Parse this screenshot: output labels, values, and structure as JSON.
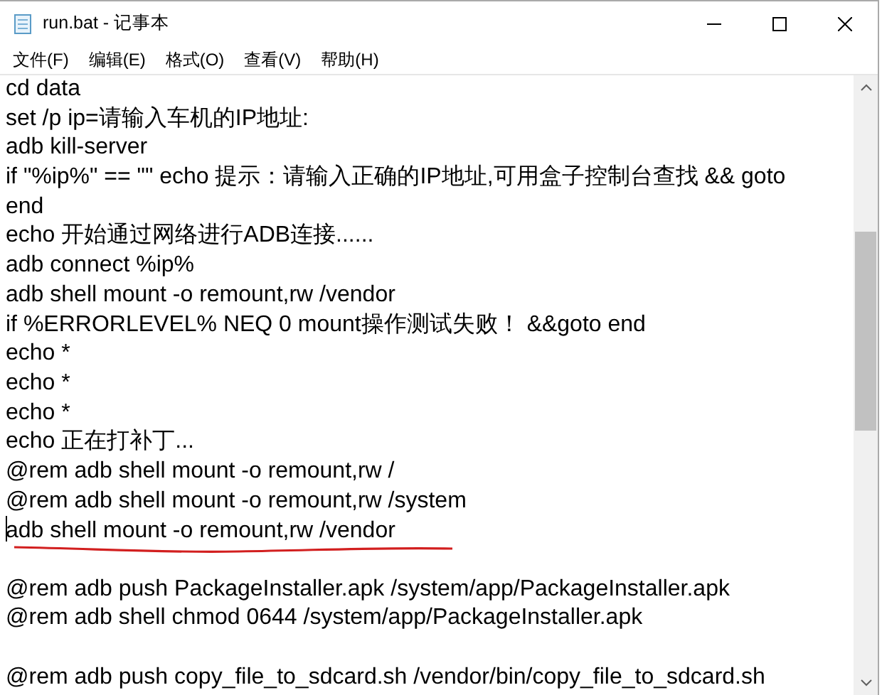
{
  "window": {
    "title": "run.bat - 记事本"
  },
  "menu": [
    "文件(F)",
    "编辑(E)",
    "格式(O)",
    "查看(V)",
    "帮助(H)"
  ],
  "lines": [
    {
      "kind": "text",
      "text": "cd data"
    },
    {
      "kind": "text",
      "text": "set /p ip=请输入车机的IP地址:"
    },
    {
      "kind": "text",
      "text": "adb kill-server"
    },
    {
      "kind": "text",
      "text": "if \"%ip%\" == \"\" echo 提示：请输入正确的IP地址,可用盒子控制台查找 && goto"
    },
    {
      "kind": "text",
      "text": "end"
    },
    {
      "kind": "text",
      "text": "echo 开始通过网络进行ADB连接......"
    },
    {
      "kind": "text",
      "text": "adb connect %ip%"
    },
    {
      "kind": "text",
      "text": "adb shell mount -o remount,rw /vendor"
    },
    {
      "kind": "text",
      "text": "if %ERRORLEVEL% NEQ 0 mount操作测试失败！ &&goto end"
    },
    {
      "kind": "text",
      "text": "echo *"
    },
    {
      "kind": "text",
      "text": "echo *"
    },
    {
      "kind": "text",
      "text": "echo *"
    },
    {
      "kind": "text",
      "text": "echo 正在打补丁..."
    },
    {
      "kind": "text",
      "text": "@rem adb shell mount -o remount,rw /"
    },
    {
      "kind": "text",
      "text": "@rem adb shell mount -o remount,rw /system"
    },
    {
      "kind": "text",
      "text": "adb shell mount -o remount,rw /vendor",
      "caret": true,
      "underlined": true
    },
    {
      "kind": "blank"
    },
    {
      "kind": "text",
      "text": "@rem adb push PackageInstaller.apk /system/app/PackageInstaller.apk"
    },
    {
      "kind": "text",
      "text": "@rem adb shell chmod 0644 /system/app/PackageInstaller.apk"
    },
    {
      "kind": "blank"
    },
    {
      "kind": "text",
      "text": "@rem adb push copy_file_to_sdcard.sh /vendor/bin/copy_file_to_sdcard.sh"
    }
  ]
}
